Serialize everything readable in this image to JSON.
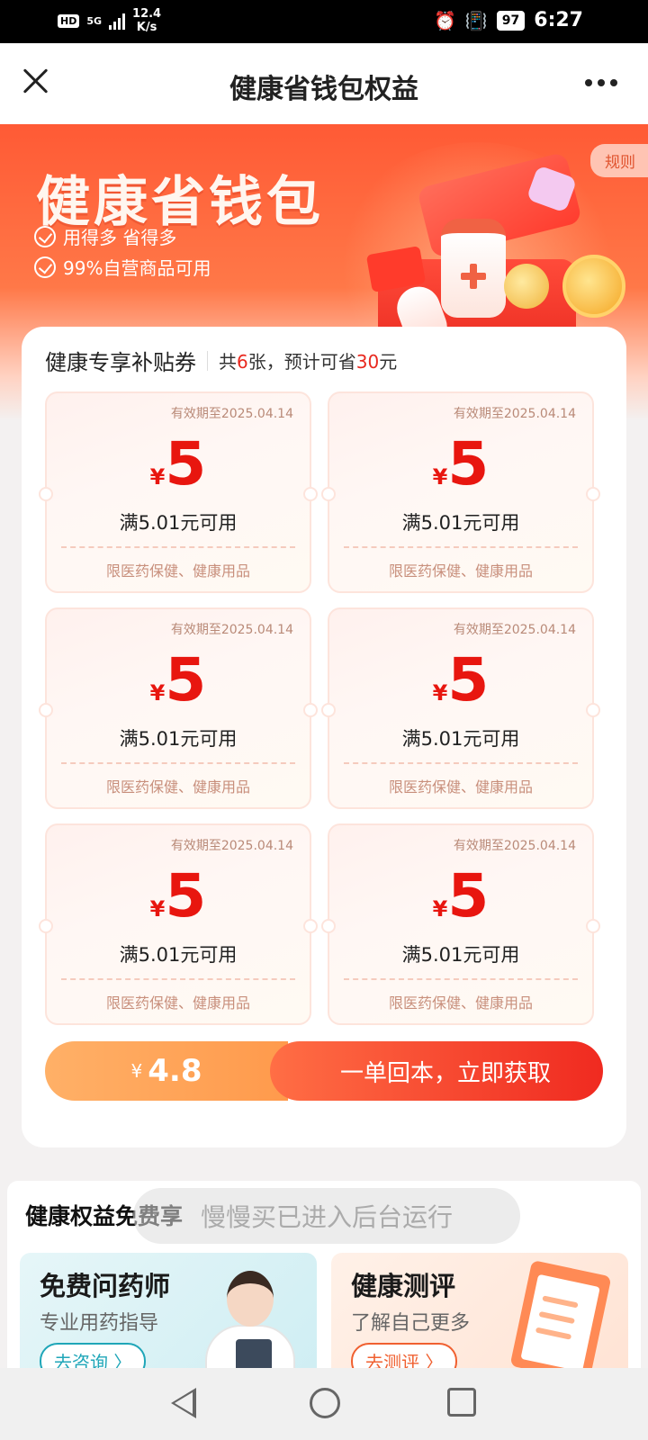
{
  "status_bar": {
    "hd": "HD",
    "network": "5G",
    "speed_value": "12.4",
    "speed_unit": "K/s",
    "battery": "97",
    "time": "6:27",
    "icons": [
      "alarm-icon",
      "vibrate-icon",
      "battery-icon",
      "signal-icon"
    ]
  },
  "header": {
    "title": "健康省钱包权益",
    "close_icon": "close-icon",
    "more_icon": "more-icon"
  },
  "banner": {
    "title": "健康省钱包",
    "perks": [
      "用得多 省得多",
      "99%自营商品可用"
    ],
    "rules_label": "规则"
  },
  "coupon_section": {
    "title": "健康专享补贴券",
    "summary_prefix": "共",
    "count": "6",
    "summary_mid": "张，预计可省",
    "savings": "30",
    "summary_suffix": "元",
    "coupons": [
      {
        "expiry": "有效期至2025.04.14",
        "currency": "¥",
        "amount": "5",
        "condition": "满5.01元可用",
        "scope": "限医药保健、健康用品"
      },
      {
        "expiry": "有效期至2025.04.14",
        "currency": "¥",
        "amount": "5",
        "condition": "满5.01元可用",
        "scope": "限医药保健、健康用品"
      },
      {
        "expiry": "有效期至2025.04.14",
        "currency": "¥",
        "amount": "5",
        "condition": "满5.01元可用",
        "scope": "限医药保健、健康用品"
      },
      {
        "expiry": "有效期至2025.04.14",
        "currency": "¥",
        "amount": "5",
        "condition": "满5.01元可用",
        "scope": "限医药保健、健康用品"
      },
      {
        "expiry": "有效期至2025.04.14",
        "currency": "¥",
        "amount": "5",
        "condition": "满5.01元可用",
        "scope": "限医药保健、健康用品"
      },
      {
        "expiry": "有效期至2025.04.14",
        "currency": "¥",
        "amount": "5",
        "condition": "满5.01元可用",
        "scope": "限医药保健、健康用品"
      }
    ],
    "price_currency": "¥",
    "price": "4.8",
    "buy_label": "一单回本，立即获取"
  },
  "benefits": {
    "title": "健康权益免费享",
    "toast": "慢慢买已进入后台运行",
    "cards": [
      {
        "title": "免费问药师",
        "subtitle": "专业用药指导",
        "button": "去咨询 〉"
      },
      {
        "title": "健康测评",
        "subtitle": "了解自己更多",
        "button": "去测评 〉"
      }
    ]
  },
  "navbar": {
    "icons": [
      "back-icon",
      "home-icon",
      "recent-apps-icon"
    ]
  },
  "colors": {
    "accent_red": "#e8281e",
    "banner_orange": "#ff5a35",
    "price_orange": "#ff9a4c"
  }
}
